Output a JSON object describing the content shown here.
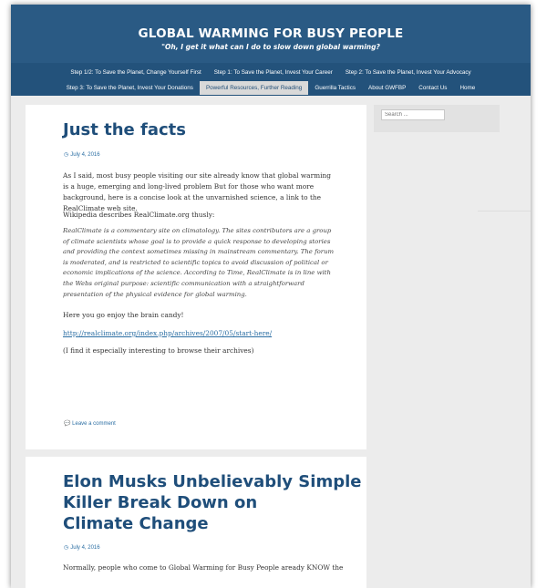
{
  "site": {
    "title": "GLOBAL WARMING FOR BUSY PEOPLE",
    "tagline": "\"Oh, I get it what can I do to slow down global warming?"
  },
  "nav": {
    "row1": [
      {
        "label": "Step 1/2: To Save the Planet, Change Yourself First"
      },
      {
        "label": "Step 1: To Save the Planet, Invest Your Career"
      },
      {
        "label": "Step 2: To Save the Planet, Invest Your Advocacy"
      }
    ],
    "row2": [
      {
        "label": "Step 3: To Save the Planet, Invest Your Donations"
      },
      {
        "label": "Powerful Resources, Further Reading",
        "active": true
      },
      {
        "label": "Guerrilla Tactics"
      },
      {
        "label": "About GWFBP"
      },
      {
        "label": "Contact Us"
      },
      {
        "label": "Home"
      }
    ]
  },
  "post1": {
    "title": "Just the facts",
    "date": "July 4, 2016",
    "para1": "As I said, most busy people visiting our site already know that global warming is a huge, emerging and long-lived problem But for those who want more background, here is a concise look at the unvarnished science, a link to the RealClimate web site.",
    "para2": "Wikipedia describes RealClimate.org thusly:",
    "quote": "RealClimate is a commentary site on climatology. The sites contributors are a group of climate scientists whose goal is to provide a quick response to developing stories and providing the context sometimes missing in mainstream commentary. The forum is moderated, and is restricted to scientific topics to avoid discussion of political or economic implications of the science. According to Time, RealClimate is in line with the Webs original purpose: scientific communication with a straightforward presentation of the physical evidence for global warming.",
    "para3": "Here you go enjoy the brain candy!",
    "link": "http://realclimate.org/index.php/archives/2007/05/start-here/",
    "para4": "(I find it especially interesting to browse their archives)",
    "comment": "Leave a comment"
  },
  "post2": {
    "title_line1": "Elon Musks Unbelievably Simple",
    "title_line2": "Killer Break Down on",
    "title_line3": "Climate Change",
    "date": "July 4, 2016",
    "para1": "Normally, people who come to Global Warming for Busy People aready KNOW the"
  },
  "sidebar": {
    "search_placeholder": "Search ..."
  },
  "icons": {
    "date": "clock-icon",
    "comment": "speech-bubble-icon"
  },
  "colors": {
    "header": "#2a5a84",
    "nav": "#23527b",
    "title": "#1f4e7a",
    "link": "#2b6ea3"
  }
}
